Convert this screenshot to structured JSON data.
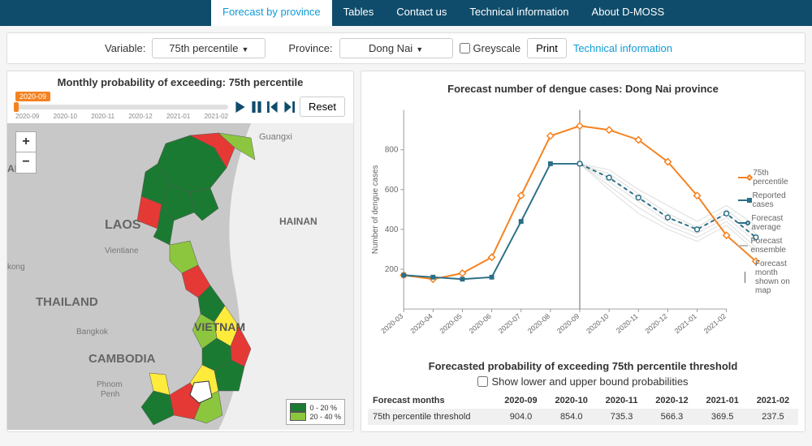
{
  "nav": {
    "tabs": [
      "Forecast by province",
      "Tables",
      "Contact us",
      "Technical information",
      "About D-MOSS"
    ],
    "active_index": 0
  },
  "controls": {
    "variable_label": "Variable:",
    "variable_value": "75th percentile",
    "province_label": "Province:",
    "province_value": "Dong Nai",
    "greyscale_label": "Greyscale",
    "print_label": "Print",
    "tech_info_link": "Technical information"
  },
  "map_panel": {
    "title": "Monthly probability of exceeding: 75th percentile",
    "slider_value": "2020-09",
    "slider_ticks": [
      "2020-09",
      "2020-10",
      "2020-11",
      "2020-12",
      "2021-01",
      "2021-02"
    ],
    "reset_label": "Reset",
    "basemap_labels": [
      "Guangxi",
      "LAOS",
      "HAINAN",
      "Vientiane",
      "THAILAND",
      "Bangkok",
      "VIETNAM",
      "CAMBODIA",
      "Phnom Penh",
      "kong",
      "AR"
    ],
    "legend": [
      {
        "label": "0 - 20 %",
        "color": "#1b7a32"
      },
      {
        "label": "20 - 40 %",
        "color": "#8cc63f"
      }
    ]
  },
  "chart_panel": {
    "title": "Forecast number of dengue cases: Dong Nai province",
    "y_axis_label": "Number of dengue cases",
    "legend": {
      "p75": "75th percentile",
      "reported": "Reported cases",
      "forecast_avg": "Forecast average",
      "forecast_ens": "Forecast ensemble",
      "forecast_month": "Forecast month shown on map"
    }
  },
  "table_panel": {
    "title": "Forecasted probability of exceeding 75th percentile threshold",
    "show_bounds_label": "Show lower and upper bound probabilities",
    "header_label": "Forecast months",
    "columns": [
      "2020-09",
      "2020-10",
      "2020-11",
      "2020-12",
      "2021-01",
      "2021-02"
    ],
    "rows": [
      {
        "label": "75th percentile threshold",
        "values": [
          "904.0",
          "854.0",
          "735.3",
          "566.3",
          "369.5",
          "237.5"
        ]
      }
    ]
  },
  "chart_data": {
    "type": "line",
    "xlabel": "",
    "ylabel": "Number of dengue cases",
    "ylim": [
      0,
      1000
    ],
    "x": [
      "2020-03",
      "2020-04",
      "2020-05",
      "2020-06",
      "2020-07",
      "2020-08",
      "2020-09",
      "2020-10",
      "2020-11",
      "2020-12",
      "2021-01",
      "2021-02"
    ],
    "y_ticks": [
      200,
      400,
      600,
      800
    ],
    "series": [
      {
        "name": "75th percentile",
        "color": "#f58220",
        "values": [
          170,
          150,
          180,
          260,
          570,
          870,
          920,
          900,
          850,
          740,
          570,
          370,
          240
        ]
      },
      {
        "name": "Reported cases",
        "color": "#2b6f86",
        "values": [
          170,
          160,
          150,
          160,
          440,
          730,
          730,
          null,
          null,
          null,
          null,
          null,
          null
        ]
      },
      {
        "name": "Forecast average",
        "color": "#2b6f86",
        "dash": true,
        "values": [
          null,
          null,
          null,
          null,
          null,
          null,
          730,
          660,
          560,
          460,
          400,
          480,
          360
        ]
      }
    ],
    "ensemble": {
      "color": "#bbbbbb",
      "members": [
        [
          730,
          700,
          600,
          520,
          440,
          520,
          420
        ],
        [
          730,
          680,
          580,
          480,
          410,
          500,
          380
        ],
        [
          730,
          660,
          560,
          460,
          400,
          480,
          360
        ],
        [
          730,
          640,
          540,
          440,
          380,
          460,
          340
        ],
        [
          730,
          620,
          510,
          420,
          360,
          440,
          310
        ],
        [
          730,
          600,
          480,
          400,
          340,
          420,
          290
        ]
      ],
      "x_start_index": 6
    },
    "forecast_month_index": 6
  },
  "colors": {
    "accent_orange": "#f58220",
    "accent_teal": "#2b6f86",
    "nav_bg": "#0f4c6b",
    "link": "#0f9bd8"
  }
}
